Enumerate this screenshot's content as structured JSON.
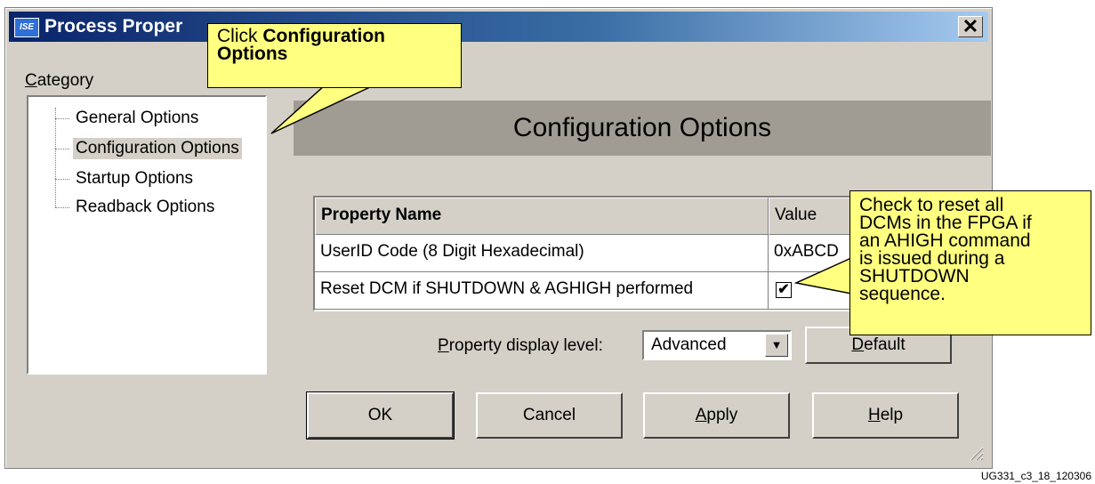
{
  "window": {
    "title": "Process Proper",
    "app_icon_text": "ISE",
    "close_glyph": "✕"
  },
  "category": {
    "label_accel": "C",
    "label_rest": "ategory",
    "items": [
      {
        "label": "General Options",
        "selected": false
      },
      {
        "label": "Configuration Options",
        "selected": true
      },
      {
        "label": "Startup Options",
        "selected": false
      },
      {
        "label": "Readback Options",
        "selected": false
      }
    ]
  },
  "panel": {
    "header": "Configuration Options"
  },
  "properties": {
    "columns": [
      "Property Name",
      "Value"
    ],
    "rows": [
      {
        "name": "UserID Code (8 Digit Hexadecimal)",
        "value": "0xABCD"
      },
      {
        "name": "Reset DCM if SHUTDOWN & AGHIGH performed",
        "value": "✔",
        "checked": true
      }
    ]
  },
  "display_level": {
    "label_accel": "P",
    "label_rest": "roperty display level:",
    "value": "Advanced",
    "arrow_glyph": "▼"
  },
  "buttons": {
    "default_accel": "D",
    "default_rest": "efault",
    "ok": "OK",
    "cancel": "Cancel",
    "apply_accel": "A",
    "apply_rest": "pply",
    "help_accel": "H",
    "help_rest": "elp"
  },
  "callouts": {
    "top_prefix": "Click ",
    "top_bold_1": "Configuration",
    "top_bold_2": "Options",
    "right_lines": [
      "Check to reset all",
      "DCMs in the FPGA if",
      "an AHIGH command",
      "is issued during a",
      "SHUTDOWN",
      "sequence."
    ],
    "fill_color": "#ffff80"
  },
  "figure_id": "UG331_c3_18_120306",
  "colors": {
    "dialog_bg": "#d4d0c8",
    "title_start": "#0a246a",
    "title_end": "#a6caf0",
    "header_bar": "#a09c94"
  }
}
